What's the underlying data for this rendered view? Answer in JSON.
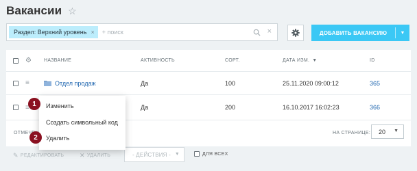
{
  "page": {
    "title": "Вакансии"
  },
  "filter": {
    "tag_label": "Раздел: Верхний уровень",
    "tag_close": "×",
    "placeholder": "+ поиск",
    "clear": "×"
  },
  "toolbar": {
    "add_label": "ДОБАВИТЬ ВАКАНСИЮ",
    "add_arrow": "▼"
  },
  "table": {
    "headers": {
      "name": "НАЗВАНИЕ",
      "active": "АКТИВНОСТЬ",
      "sort": "СОРТ.",
      "date": "ДАТА ИЗМ.",
      "date_sort": "▼",
      "id": "ID"
    },
    "rows": [
      {
        "name": "Отдел продаж",
        "active": "Да",
        "sort": "100",
        "date": "25.11.2020 09:00:12",
        "id": "365",
        "is_folder": true
      },
      {
        "name": "",
        "active": "Да",
        "sort": "200",
        "date": "16.10.2017 16:02:23",
        "id": "366",
        "is_folder": false
      }
    ]
  },
  "footer": {
    "selected_label": "ОТМЕЧЕН",
    "page_size_label": "НА СТРАНИЦЕ:",
    "page_size": "20",
    "page_size_chev": "▼"
  },
  "actions": {
    "edit": "РЕДАКТИРОВАТЬ",
    "delete": "УДАЛИТЬ",
    "actions_select": "- ДЕЙСТВИЯ -",
    "actions_chev": "▼",
    "for_all": "ДЛЯ ВСЕХ"
  },
  "context_menu": {
    "items": [
      "Изменить",
      "Создать символьный код",
      "Удалить"
    ]
  },
  "annotations": [
    "1",
    "2"
  ],
  "colors": {
    "accent": "#3bc8f5",
    "tag": "#bcedfc",
    "link": "#2067b0",
    "badge": "#8a1020"
  }
}
